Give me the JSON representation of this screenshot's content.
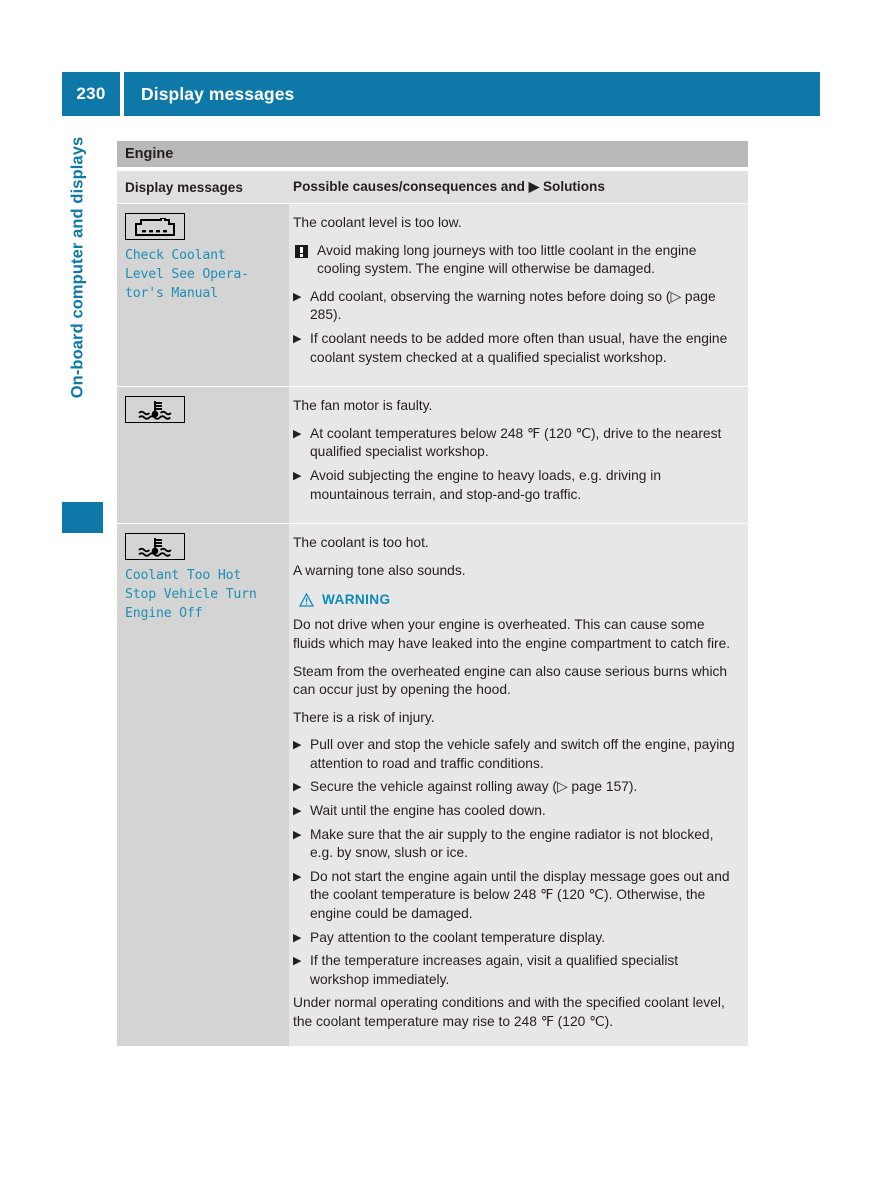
{
  "header": {
    "page_number": "230",
    "title": "Display messages",
    "accent_color": "#0e78a8"
  },
  "chapter_tab": {
    "label": "On-board computer and displays",
    "color": "#0e78a8"
  },
  "table": {
    "section_title": "Engine",
    "columns": {
      "left": "Display messages",
      "right": "Possible causes/consequences and ▶ Solutions"
    },
    "rows": [
      {
        "icon_name": "coolant-reservoir-level-icon",
        "message": "Check Coolant\nLevel See Opera-\ntor's Manual",
        "message_color": "#1e8fb5",
        "content": [
          {
            "kind": "para",
            "text": "The coolant level is too low."
          },
          {
            "kind": "note",
            "text": "Avoid making long journeys with too little coolant in the engine cooling system. The engine will otherwise be damaged."
          },
          {
            "kind": "bullet",
            "text": "Add coolant, observing the warning notes before doing so (▷ page 285)."
          },
          {
            "kind": "bullet",
            "text": "If coolant needs to be added more often than usual, have the engine coolant system checked at a qualified specialist workshop."
          }
        ]
      },
      {
        "icon_name": "coolant-temperature-icon",
        "message": "",
        "message_color": "#1e8fb5",
        "content": [
          {
            "kind": "para",
            "text": "The fan motor is faulty."
          },
          {
            "kind": "bullet",
            "text": "At coolant temperatures below 248 ℉ (120 ℃), drive to the nearest qualified specialist workshop."
          },
          {
            "kind": "bullet",
            "text": "Avoid subjecting the engine to heavy loads, e.g. driving in mountainous terrain, and stop-and-go traffic."
          }
        ]
      },
      {
        "icon_name": "coolant-temperature-icon",
        "message": "Coolant Too Hot\nStop Vehicle Turn\nEngine Off",
        "message_color": "#1e8fb5",
        "content": [
          {
            "kind": "para",
            "text": "The coolant is too hot."
          },
          {
            "kind": "para",
            "text": "A warning tone also sounds."
          },
          {
            "kind": "warnhead",
            "text": "WARNING"
          },
          {
            "kind": "para",
            "text": "Do not drive when your engine is overheated. This can cause some fluids which may have leaked into the engine compartment to catch fire."
          },
          {
            "kind": "para",
            "text": "Steam from the overheated engine can also cause serious burns which can occur just by opening the hood."
          },
          {
            "kind": "para",
            "text": "There is a risk of injury."
          },
          {
            "kind": "bullet",
            "text": "Pull over and stop the vehicle safely and switch off the engine, paying attention to road and traffic conditions."
          },
          {
            "kind": "bullet",
            "text": "Secure the vehicle against rolling away (▷ page 157)."
          },
          {
            "kind": "bullet",
            "text": "Wait until the engine has cooled down."
          },
          {
            "kind": "bullet",
            "text": "Make sure that the air supply to the engine radiator is not blocked, e.g. by snow, slush or ice."
          },
          {
            "kind": "bullet",
            "text": "Do not start the engine again until the display message goes out and the coolant temperature is below 248 ℉ (120 ℃). Otherwise, the engine could be damaged."
          },
          {
            "kind": "bullet",
            "text": "Pay attention to the coolant temperature display."
          },
          {
            "kind": "bullet",
            "text": "If the temperature increases again, visit a qualified specialist workshop immediately."
          },
          {
            "kind": "para",
            "text": "Under normal operating conditions and with the specified coolant level, the coolant temperature may rise to 248 ℉ (120 ℃)."
          }
        ]
      }
    ]
  },
  "icons": {
    "bullet_arrow": "▶",
    "warning_triangle": "warning-triangle-icon",
    "note_exclamation": "note-exclamation-icon"
  }
}
